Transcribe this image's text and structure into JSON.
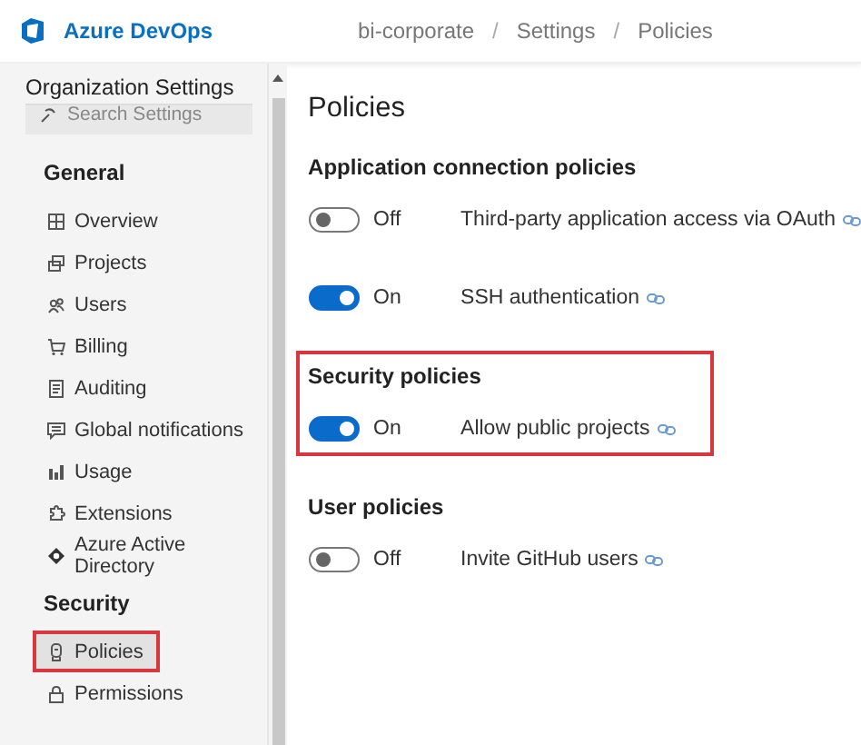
{
  "header": {
    "product": "Azure DevOps",
    "breadcrumb": [
      {
        "kind": "crumb",
        "text": "bi-corporate"
      },
      {
        "kind": "separator",
        "text": "/"
      },
      {
        "kind": "crumb",
        "text": "Settings"
      },
      {
        "kind": "separator",
        "text": "/"
      },
      {
        "kind": "crumb",
        "text": "Policies"
      }
    ]
  },
  "sidebar": {
    "title": "Organization Settings",
    "search": {
      "placeholder": "Search Settings"
    },
    "groups": [
      {
        "title": "General",
        "items": [
          {
            "label": "Overview",
            "selected": false,
            "highlighted": false
          },
          {
            "label": "Projects",
            "selected": false,
            "highlighted": false
          },
          {
            "label": "Users",
            "selected": false,
            "highlighted": false
          },
          {
            "label": "Billing",
            "selected": false,
            "highlighted": false
          },
          {
            "label": "Auditing",
            "selected": false,
            "highlighted": false
          },
          {
            "label": "Global notifications",
            "selected": false,
            "highlighted": false
          },
          {
            "label": "Usage",
            "selected": false,
            "highlighted": false
          },
          {
            "label": "Extensions",
            "selected": false,
            "highlighted": false
          },
          {
            "label": "Azure Active Directory",
            "selected": false,
            "highlighted": false
          }
        ]
      },
      {
        "title": "Security",
        "items": [
          {
            "label": "Policies",
            "selected": true,
            "highlighted": true
          },
          {
            "label": "Permissions",
            "selected": false,
            "highlighted": false
          }
        ]
      }
    ]
  },
  "main": {
    "title": "Policies",
    "sections": [
      {
        "title": "Application connection policies",
        "highlighted": false,
        "policies": [
          {
            "on": false,
            "state_label": "Off",
            "name": "Third-party application access via OAuth"
          },
          {
            "on": true,
            "state_label": "On",
            "name": "SSH authentication"
          }
        ]
      },
      {
        "title": "Security policies",
        "highlighted": true,
        "policies": [
          {
            "on": true,
            "state_label": "On",
            "name": "Allow public projects"
          }
        ]
      },
      {
        "title": "User policies",
        "highlighted": false,
        "policies": [
          {
            "on": false,
            "state_label": "Off",
            "name": "Invite GitHub users"
          }
        ]
      }
    ]
  }
}
